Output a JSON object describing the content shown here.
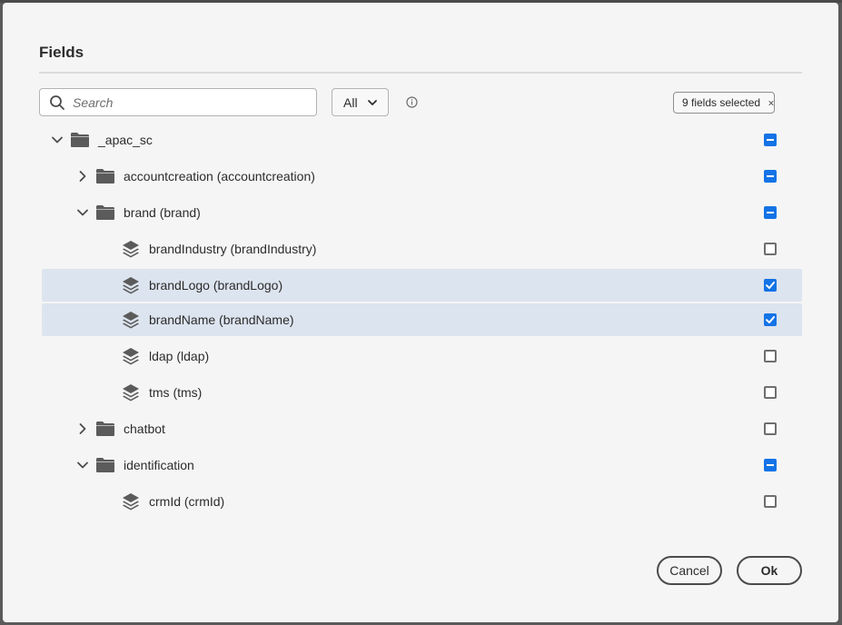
{
  "dialog": {
    "title": "Fields"
  },
  "toolbar": {
    "search_placeholder": "Search",
    "search_value": "",
    "filter_value": "All",
    "selected_tag": "9 fields selected"
  },
  "tree": [
    {
      "label": "_apac_sc",
      "kind": "folder",
      "depth": 0,
      "expander": "expanded",
      "checkbox": "partial",
      "selected": false
    },
    {
      "label": "accountcreation (accountcreation)",
      "kind": "folder",
      "depth": 1,
      "expander": "collapsed",
      "checkbox": "partial",
      "selected": false
    },
    {
      "label": "brand (brand)",
      "kind": "folder",
      "depth": 1,
      "expander": "expanded",
      "checkbox": "partial",
      "selected": false
    },
    {
      "label": "brandIndustry (brandIndustry)",
      "kind": "field",
      "depth": 2,
      "expander": "none",
      "checkbox": "empty",
      "selected": false
    },
    {
      "label": "brandLogo (brandLogo)",
      "kind": "field",
      "depth": 2,
      "expander": "none",
      "checkbox": "checked",
      "selected": true
    },
    {
      "label": "brandName (brandName)",
      "kind": "field",
      "depth": 2,
      "expander": "none",
      "checkbox": "checked",
      "selected": true
    },
    {
      "label": "ldap (ldap)",
      "kind": "field",
      "depth": 2,
      "expander": "none",
      "checkbox": "empty",
      "selected": false
    },
    {
      "label": "tms (tms)",
      "kind": "field",
      "depth": 2,
      "expander": "none",
      "checkbox": "empty",
      "selected": false
    },
    {
      "label": "chatbot",
      "kind": "folder",
      "depth": 1,
      "expander": "collapsed",
      "checkbox": "empty",
      "selected": false
    },
    {
      "label": "identification",
      "kind": "folder",
      "depth": 1,
      "expander": "expanded",
      "checkbox": "partial",
      "selected": false
    },
    {
      "label": "crmId (crmId)",
      "kind": "field",
      "depth": 2,
      "expander": "none",
      "checkbox": "empty",
      "selected": false
    }
  ],
  "footer": {
    "cancel_label": "Cancel",
    "ok_label": "Ok"
  },
  "colors": {
    "accent": "#1473e6",
    "selected_row": "#dce4ef",
    "dialog_bg": "#f5f5f5"
  }
}
